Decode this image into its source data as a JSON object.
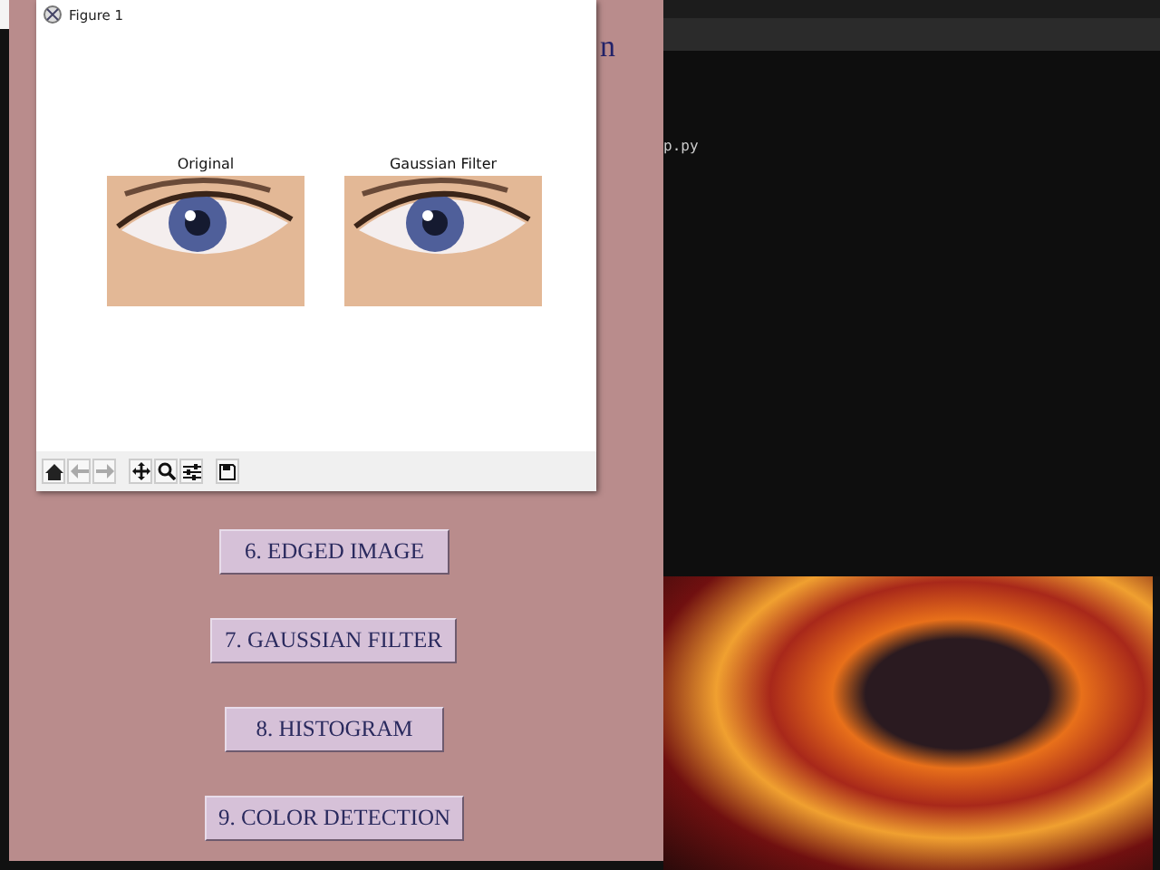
{
  "app_window": {
    "heading_fragment": "n",
    "buttons": [
      {
        "label": "6. EDGED IMAGE"
      },
      {
        "label": "7. GAUSSIAN FILTER"
      },
      {
        "label": "8. HISTOGRAM"
      },
      {
        "label": "9. COLOR DETECTION"
      }
    ]
  },
  "figure_window": {
    "title": "Figure 1",
    "plots": [
      {
        "title": "Original"
      },
      {
        "title": "Gaussian Filter"
      }
    ]
  },
  "terminal": {
    "line_fragment": "p.py"
  }
}
